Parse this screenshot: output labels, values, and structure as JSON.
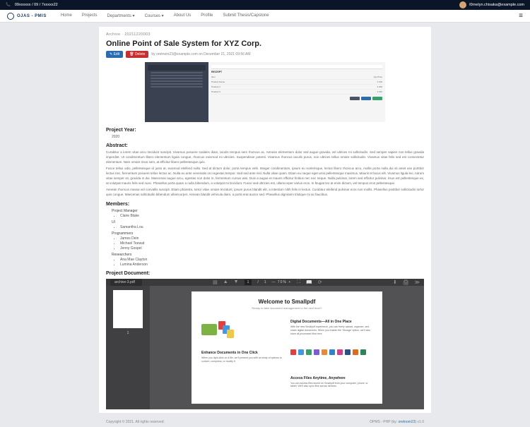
{
  "topbar": {
    "phone": "09xxxxxx / 09 / 7xxxxx22",
    "user": "l0rnelyn.chisaka@example.com"
  },
  "navbar": {
    "brand": "OJAS - PMIS",
    "links": [
      "Home",
      "Projects",
      "Departments ▾",
      "Courses ▾",
      "About Us",
      "Profile",
      "Submit Thesis/Capstone"
    ]
  },
  "breadcrumb": "Archive · 20211220003",
  "title": "Online Point of Sale System for XYZ Corp.",
  "buttons": {
    "edit": "✎ Edit",
    "delete": "🗑 Delete"
  },
  "meta": "by oretnom23@example.com on December 21, 2021 09:56 AM",
  "sections": {
    "year_h": "Project Year:",
    "year": "2020",
    "abstract_h": "Abstract:",
    "members_h": "Members:",
    "doc_h": "Project Document:"
  },
  "abstract": [
    "Curabitur a lorem vitae arcu tincidunt suscipit. Vivamus posuere sodales diam, iaculis tempus sem rhoncus ac. Aenean elementum dolor sed augue gravida, vel ultrices mi sollicitudin. Sed semper sapien non tellus gravida imperdiet. Ut condimentum libero elementum ligula congue, rhoncus euismod mi ultricies. Suspendisse potenti. Vivamus rhoncus iaculis purus, non ultrices tellus ornare sollicitudin. Vivamus vitae felis sed est consectetur elementum. Nam ornare risus sem, at efficitur libero pellentesque quis.",
    "Fusce tellus odio, pellentesque id justo at, euismod eleifend nulla. Sed at dictum dolor, porta tempus velit. Integer condimentum, ipsum eu scelerisque, lectus libero rhoncus arcu, mollis porta nulla dui sit amet use porttitor lectus nec, fermentum posuere tellus lectus ac. Nulla eu ante venenatis orci egestas tempor. Sed sed ante nisl. Nulla vitae quam. Etiam eu neque eget urna pellentesque maximus. Mauris et lacus elit. Vivamus ligula leo, rutrum vitae semper sit, gravida in dui. Maecenas augue arcu, egestas non dolor in, fermentum cursus wisi. Duis a augue et mauris efficitur finibus nec nec neque. Nulla pulvinar, lorem sed efficitur pulvinar, risus est pellentesque ex, at volutpat mauris felis sed nunc. Phasellus porta quam a nulla bibendum, a volutpat mi tincidunt. Fusce sed ultricies est, ullamcorper varius eros. In feugiat leo at enim dictum, vel tempus eros pellentesque.",
    "Aenean rhoncus massa vel convallis suscipit. Etiam pharetra, tortor vitae ornare tincidunt, ipsum purus blandit elit, a interdum nibh felis in lectus. Curabitur eleifend pulvinar eros non mollis. Phasellus posttitor sollicitudin tortor quis congue. Maecenas sollicitudin bibendum ullamcorper. Aenean blandit vehicula diam, a porta erat auctor sed. Phasellus dignissim tristique mi ac faucibus."
  ],
  "members": {
    "pm_role": "Project Manager",
    "pm": [
      "Claire Blake"
    ],
    "ui_role": "UI",
    "ui": [
      "Samantha Lou"
    ],
    "prog_role": "Programmers",
    "prog": [
      "James Dein",
      "Michael Teewat",
      "Jenny Gospel"
    ],
    "res_role": "Researchers",
    "res": [
      "Ana Mae Clayton",
      "Lumina Anderson"
    ]
  },
  "pdf": {
    "tab": "archive-3.pdf",
    "page": "1",
    "sep": "/",
    "total": "1",
    "zoom": "— 70% +",
    "welcome": "Welcome to Smallpdf",
    "welcome_sub": "Ready to take document management to the next level?",
    "s1_h": "Digital Documents—All in One Place",
    "s1_t": "With the new Smallpdf experience, you can freely upload, organize, and share digital documents. When you enable the 'Storage' option, we'll also store all processed files here.",
    "s2_h": "Enhance Documents in One Click",
    "s2_t": "When you right-click on a file, we'll present you with an array of options to convert, compress, or modify it.",
    "s3_h": "Access Files Anytime, Anywhere",
    "s3_t": "You can access files stored on Smallpdf from your computer, phone, or tablet. We'll also sync files across devices."
  },
  "footer": {
    "left": "Copyright © 2021. All rights reserved.",
    "right_prefix": "OPMS - PHP (by: ",
    "right_link": "oretnom23",
    "right_suffix": ") v1.0"
  }
}
